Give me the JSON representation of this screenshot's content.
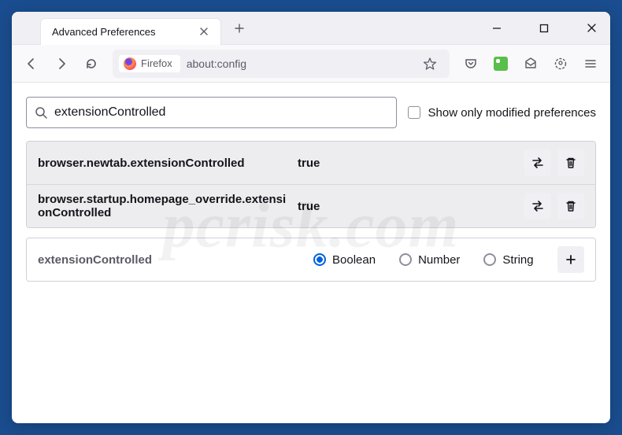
{
  "titlebar": {
    "tab_title": "Advanced Preferences"
  },
  "toolbar": {
    "brand": "Firefox",
    "url": "about:config"
  },
  "content": {
    "search_value": "extensionControlled",
    "show_modified_label": "Show only modified preferences",
    "prefs": [
      {
        "name": "browser.newtab.extensionControlled",
        "value": "true"
      },
      {
        "name": "browser.startup.homepage_override.extensionControlled",
        "value": "true"
      }
    ],
    "add_row": {
      "name": "extensionControlled",
      "types": {
        "boolean": "Boolean",
        "number": "Number",
        "string": "String"
      },
      "selected": "boolean"
    }
  }
}
